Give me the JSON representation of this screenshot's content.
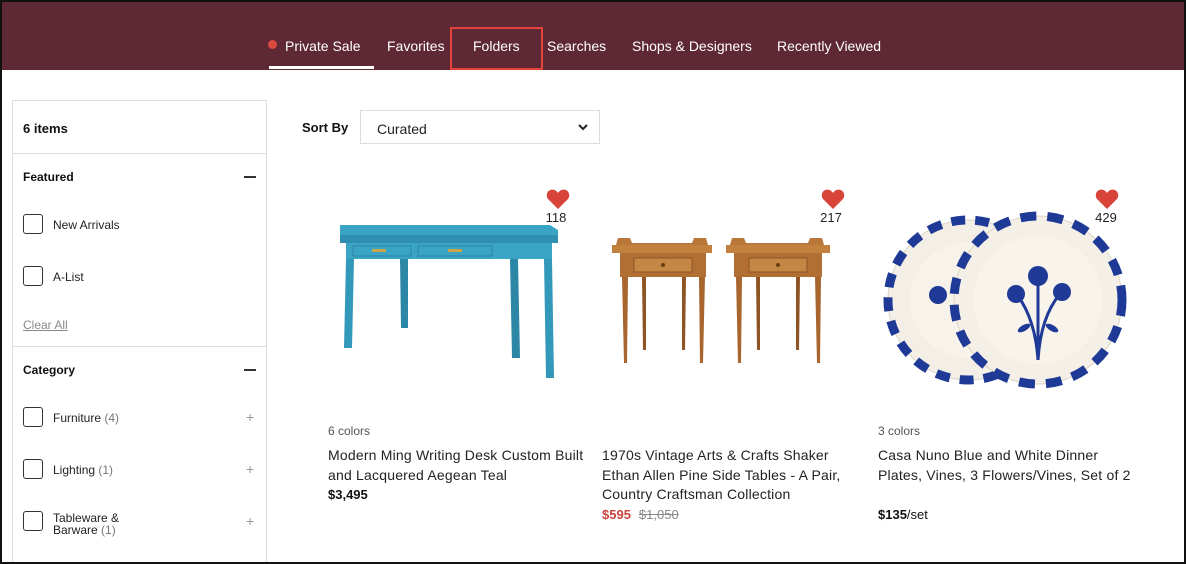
{
  "nav": {
    "items": [
      "Private Sale",
      "Favorites",
      "Folders",
      "Searches",
      "Shops & Designers",
      "Recently Viewed"
    ]
  },
  "sidebar": {
    "items_count": "6 items",
    "featured": {
      "title": "Featured",
      "options": [
        "New Arrivals",
        "A-List"
      ],
      "clear_all": "Clear All"
    },
    "category": {
      "title": "Category",
      "options": [
        {
          "label": "Furniture",
          "count": "(4)"
        },
        {
          "label": "Lighting",
          "count": "(1)"
        },
        {
          "label": "Tableware &",
          "label2": "Barware",
          "count": "(1)"
        }
      ]
    }
  },
  "sort": {
    "label": "Sort By",
    "value": "Curated"
  },
  "products": [
    {
      "favorites": "118",
      "colors": "6 colors",
      "title": "Modern Ming Writing Desk Custom Built and Lacquered Aegean Teal",
      "price": "$3,495"
    },
    {
      "favorites": "217",
      "colors": "",
      "title": "1970s Vintage Arts & Crafts Shaker Ethan Allen Pine Side Tables - A Pair, Country Craftsman Collection",
      "sale_price": "$595",
      "original_price": "$1,050"
    },
    {
      "favorites": "429",
      "colors": "3 colors",
      "title": "Casa Nuno Blue and White Dinner Plates, Vines, 3 Flowers/Vines, Set of 2",
      "price": "$135",
      "price_unit": "/set"
    }
  ],
  "colors": {
    "nav_bg": "#5f2835",
    "accent_red": "#d94b3f",
    "heart": "#d8433a",
    "desk_teal": "#3aa4c4",
    "pine": "#b9773a",
    "plate_blue": "#1f3a96"
  }
}
